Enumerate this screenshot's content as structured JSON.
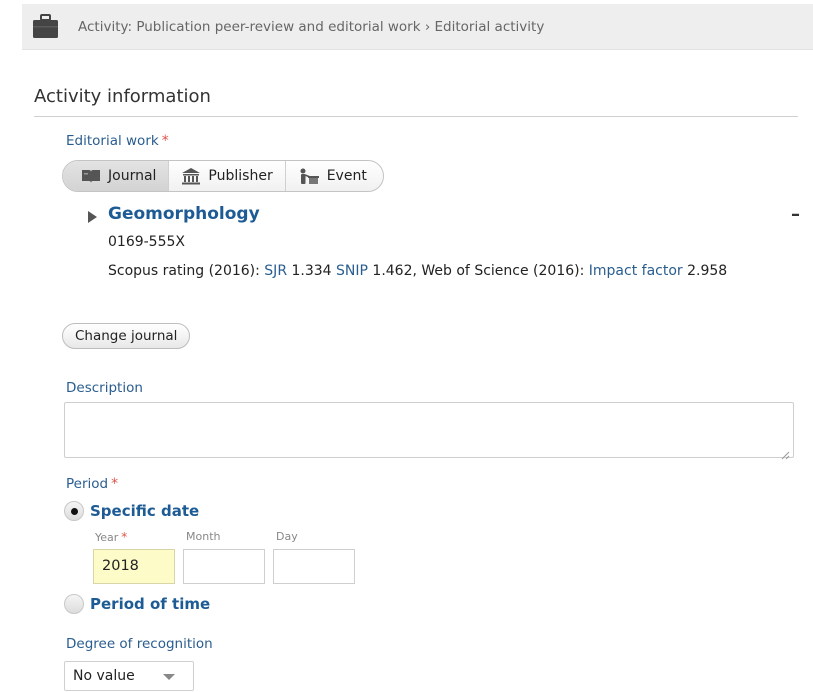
{
  "breadcrumb": {
    "text": "Activity: Publication peer-review and editorial work › Editorial activity",
    "icon": "briefcase-icon"
  },
  "section": {
    "title": "Activity information"
  },
  "editorial_work": {
    "label": "Editorial work",
    "required_mark": "*",
    "tabs": [
      {
        "label": "Journal",
        "icon": "book-icon",
        "active": true
      },
      {
        "label": "Publisher",
        "icon": "building-icon",
        "active": false
      },
      {
        "label": "Event",
        "icon": "presenter-icon",
        "active": false
      }
    ]
  },
  "journal": {
    "name": "Geomorphology",
    "issn": "0169-555X",
    "scopus_prefix": "Scopus rating (2016): ",
    "sjr_label": "SJR",
    "sjr_value": " 1.334 ",
    "snip_label": "SNIP",
    "snip_value": " 1.462, Web of Science (2016): ",
    "impact_label": "Impact factor",
    "impact_value": " 2.958",
    "collapse_symbol": "–",
    "change_button": "Change journal"
  },
  "description": {
    "label": "Description",
    "value": ""
  },
  "period": {
    "label": "Period",
    "required_mark": "*",
    "option_specific": "Specific date",
    "option_period": "Period of time",
    "selected": "specific",
    "year_label": "Year",
    "year_required": "*",
    "month_label": "Month",
    "day_label": "Day",
    "year_value": "2018",
    "month_value": "",
    "day_value": ""
  },
  "recognition": {
    "label": "Degree of recognition",
    "selected": "No value"
  },
  "colors": {
    "link": "#2a5d8f",
    "title_link": "#1d5b94",
    "required": "#e0544a",
    "year_highlight": "#fdfbc8"
  }
}
